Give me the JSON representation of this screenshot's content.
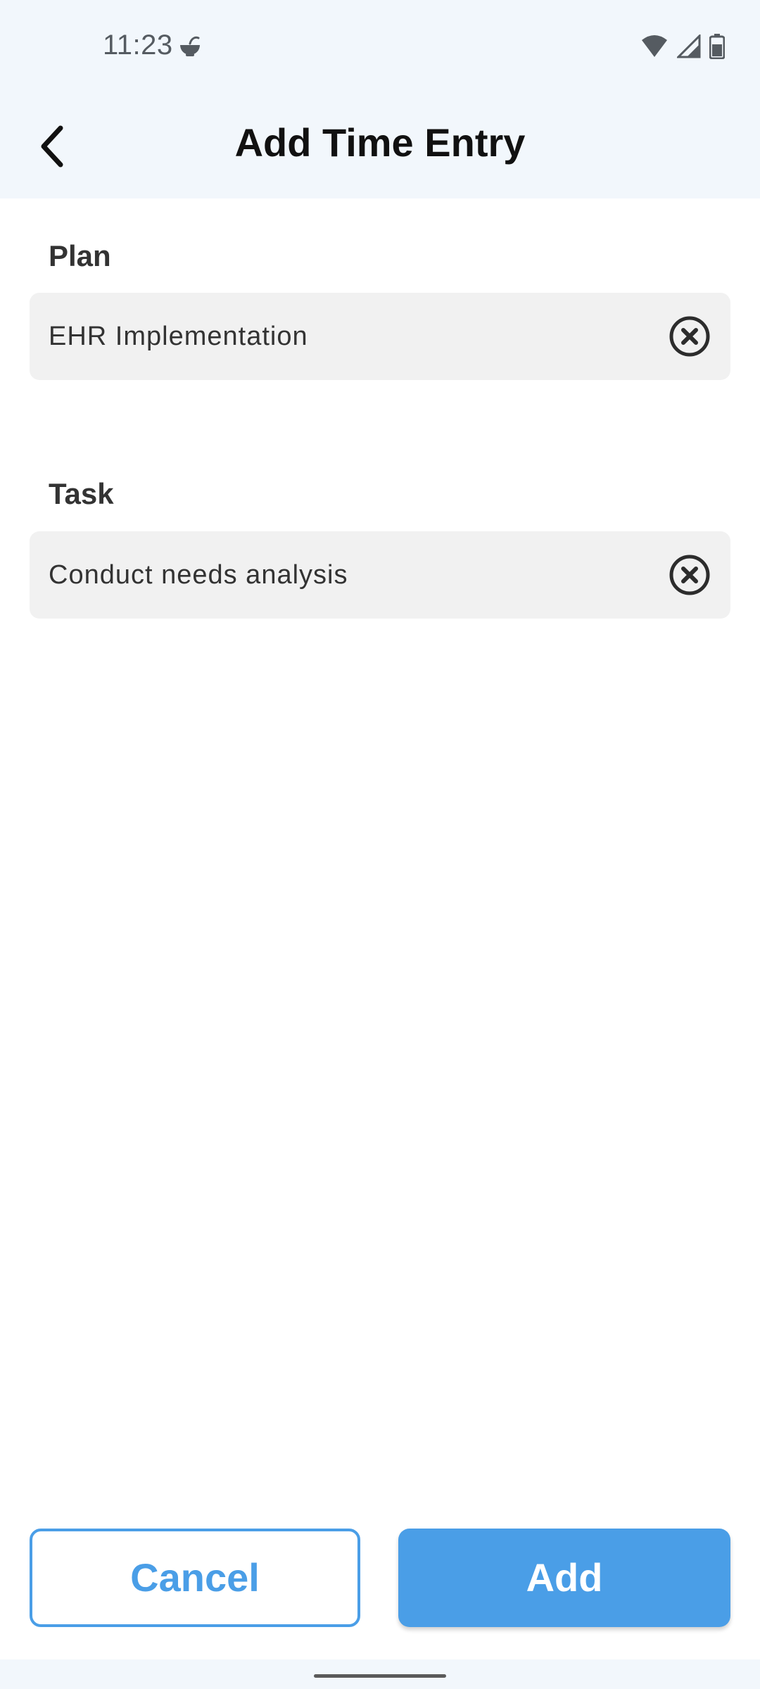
{
  "status_bar": {
    "time": "11:23",
    "icons": [
      "bowl-icon",
      "wifi-icon",
      "signal-icon",
      "battery-icon"
    ]
  },
  "header": {
    "title": "Add Time Entry",
    "back_icon": "chevron-left-icon"
  },
  "form": {
    "plan": {
      "label": "Plan",
      "value": "EHR Implementation",
      "clear_icon": "clear-circle-icon"
    },
    "task": {
      "label": "Task",
      "value": "Conduct needs analysis",
      "clear_icon": "clear-circle-icon"
    }
  },
  "actions": {
    "cancel_label": "Cancel",
    "add_label": "Add"
  },
  "colors": {
    "accent": "#4a9ee7",
    "header_bg": "#f2f7fc",
    "field_bg": "#f1f1f1"
  }
}
